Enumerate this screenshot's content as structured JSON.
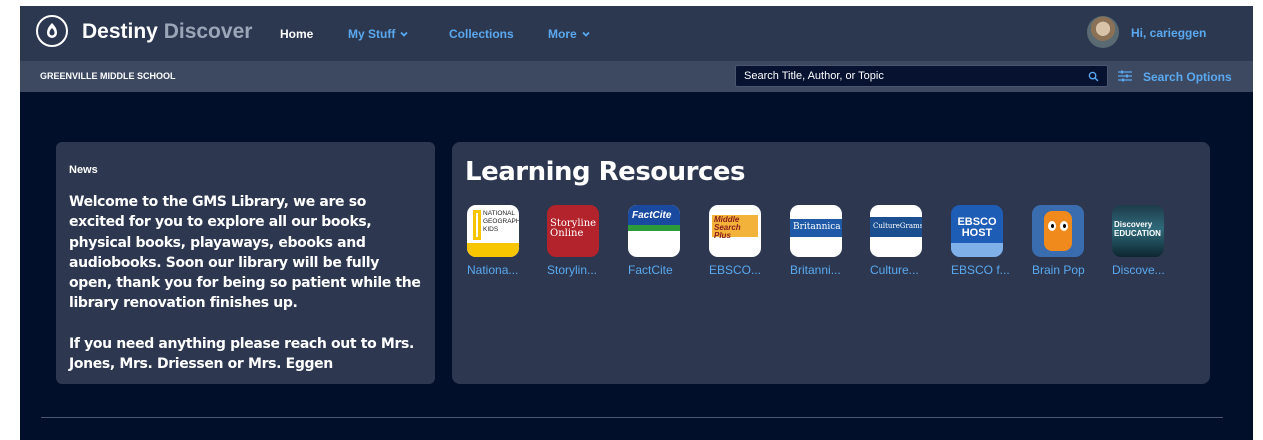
{
  "nav": {
    "brand_primary": "Destiny",
    "brand_secondary": "Discover",
    "items": [
      {
        "label": "Home"
      },
      {
        "label": "My Stuff"
      },
      {
        "label": "Collections"
      },
      {
        "label": "More"
      }
    ],
    "greeting": "Hi, carieggen"
  },
  "subbar": {
    "school": "GREENVILLE MIDDLE SCHOOL",
    "search_placeholder": "Search Title, Author, or Topic",
    "search_options": "Search Options"
  },
  "news": {
    "title": "News",
    "paragraphs": [
      "Welcome to the GMS Library, we are so excited for you to explore all our books, physical books, playaways, ebooks and audiobooks. Soon our library will be fully open, thank you for being so patient while the library renovation finishes up.",
      "If you need anything please reach out to Mrs. Jones, Mrs. Driessen or Mrs. Eggen"
    ]
  },
  "learning_resources": {
    "title": "Learning Resources",
    "items": [
      {
        "label": "Nationa...",
        "icon_text": "NATIONAL GEOGRAPHIC KIDS"
      },
      {
        "label": "Storylin...",
        "icon_text": "Storyline Online"
      },
      {
        "label": "FactCite",
        "icon_text": "FactCite"
      },
      {
        "label": "EBSCO...",
        "icon_text": "Middle Search Plus"
      },
      {
        "label": "Britanni...",
        "icon_text": "Britannica"
      },
      {
        "label": "Culture...",
        "icon_text": "CultureGrams"
      },
      {
        "label": "EBSCO f...",
        "icon_text": "EBSCO HOST"
      },
      {
        "label": "Brain Pop",
        "icon_text": ""
      },
      {
        "label": "Discove...",
        "icon_text": "Discovery EDUCATION"
      }
    ]
  },
  "colors": {
    "page_bg": "#020f2b",
    "nav_bg": "#2c3850",
    "subbar_bg": "#3d4961",
    "card_bg": "#2d3850",
    "link": "#5aa9f0"
  }
}
